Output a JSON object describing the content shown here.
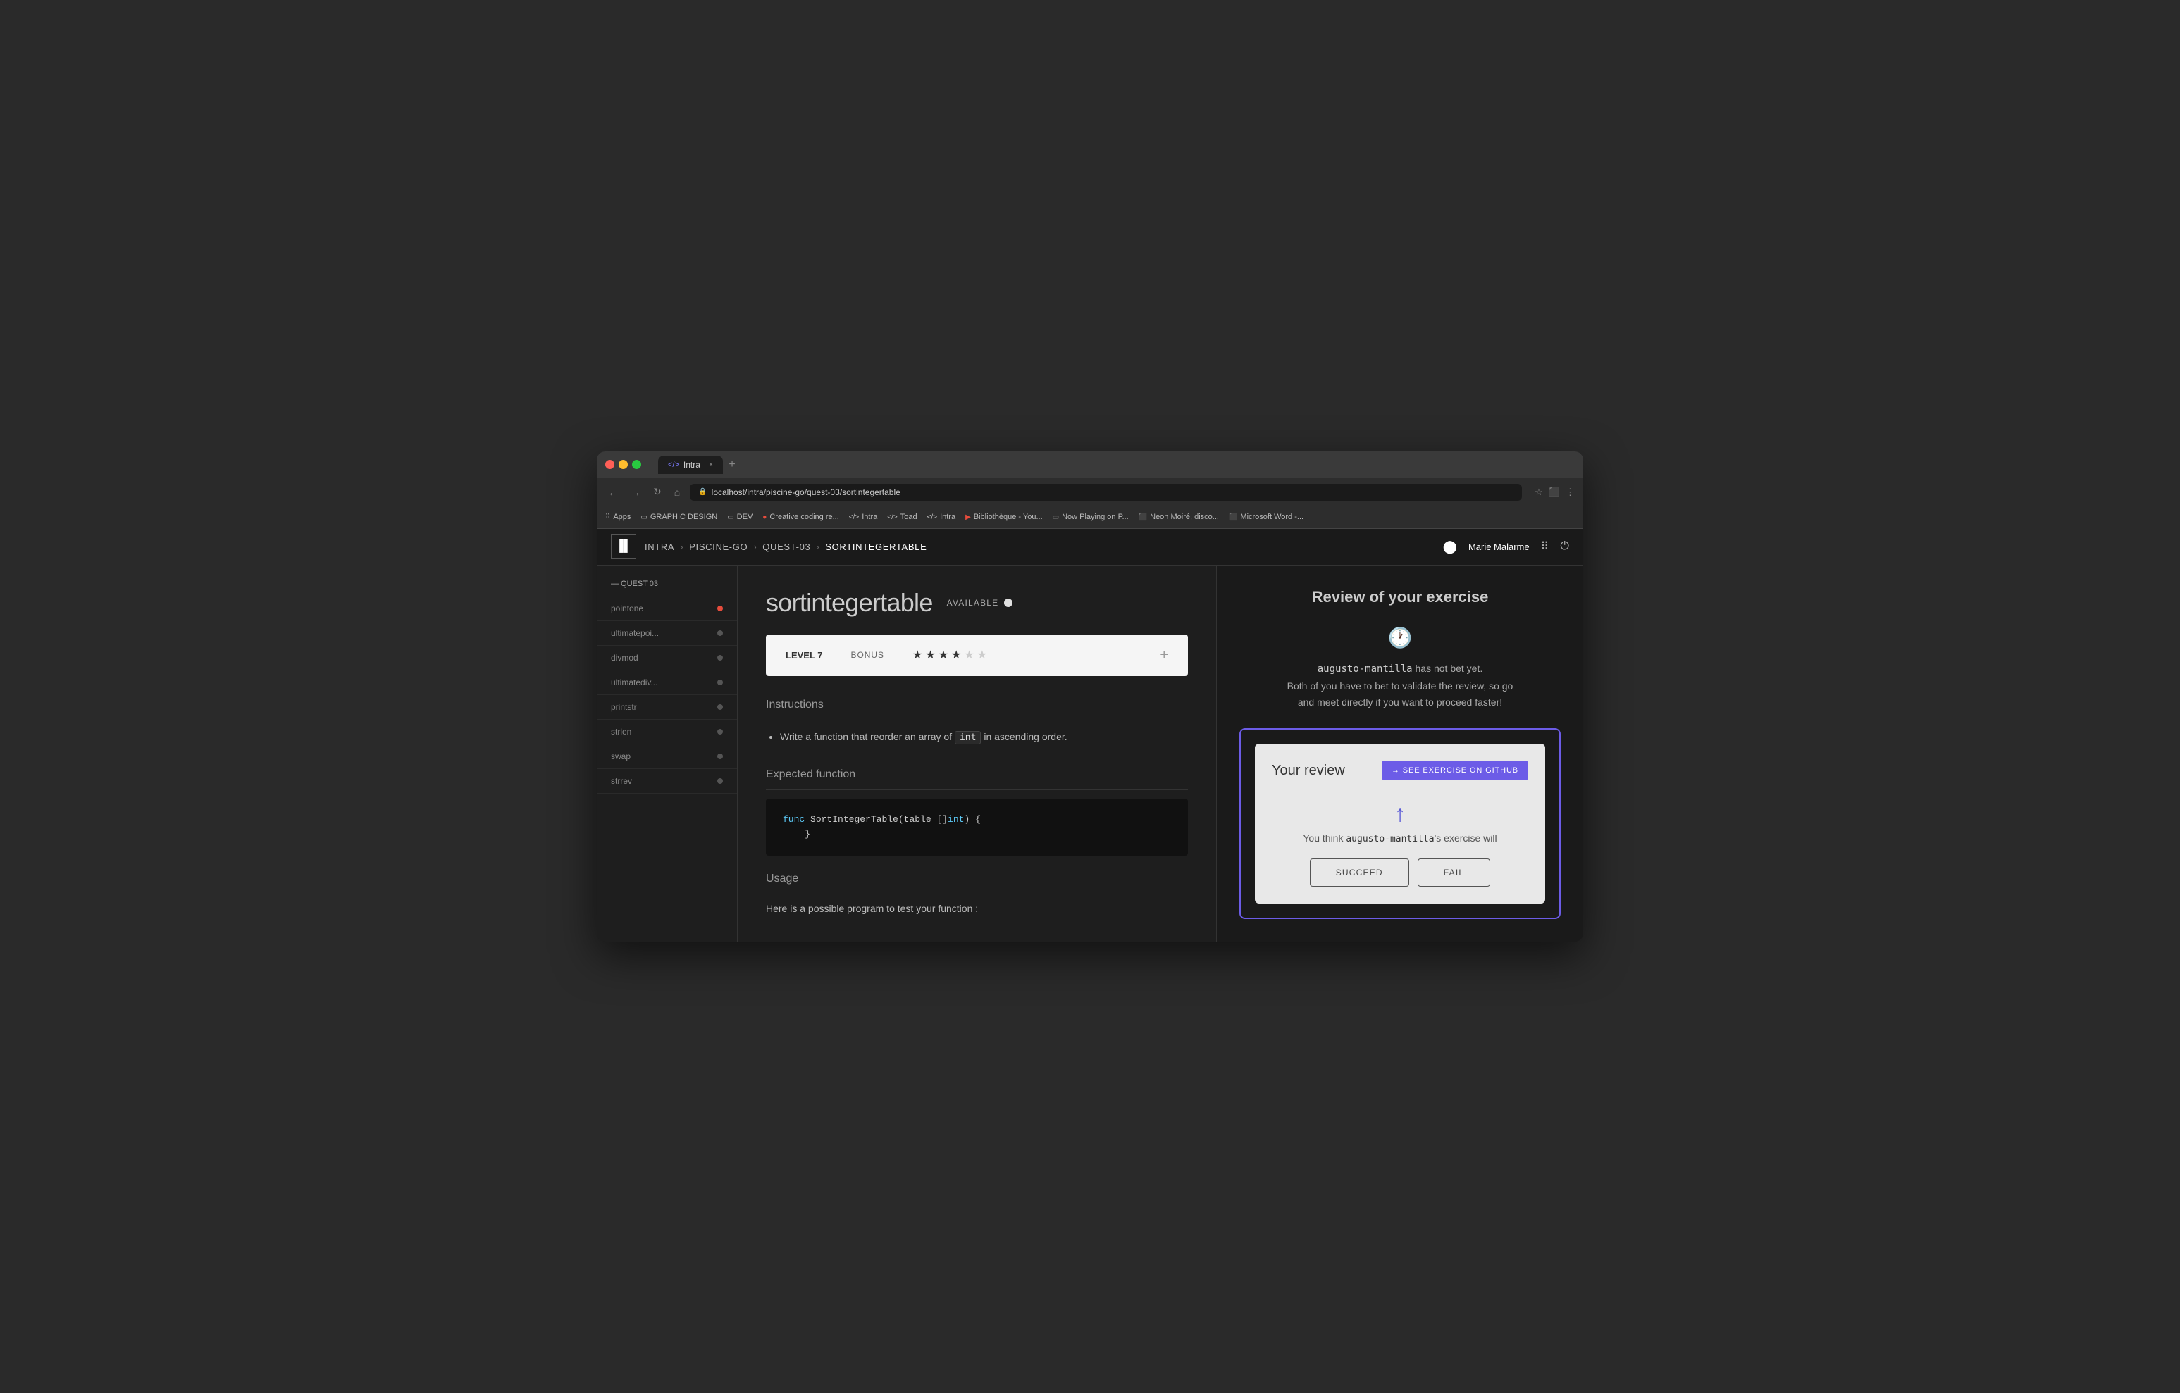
{
  "browser": {
    "tab_icon": "</>",
    "tab_title": "Intra",
    "tab_close": "×",
    "new_tab": "+",
    "url": "localhost/intra/piscine-go/quest-03/sortintegertable",
    "bookmarks": [
      {
        "icon": "⠿",
        "label": "Apps"
      },
      {
        "icon": "▭",
        "label": "GRAPHIC DESIGN"
      },
      {
        "icon": "▭",
        "label": "DEV"
      },
      {
        "icon": "🔴",
        "label": "Creative coding re..."
      },
      {
        "icon": "</>",
        "label": "Intra"
      },
      {
        "icon": "</>",
        "label": "Toad"
      },
      {
        "icon": "</>",
        "label": "Intra"
      },
      {
        "icon": "▶",
        "label": "Bibliothèque - You..."
      },
      {
        "icon": "▭",
        "label": "Now Playing on P..."
      },
      {
        "icon": "⬛",
        "label": "Neon Moiré, disco..."
      },
      {
        "icon": "⬛",
        "label": "Microsoft Word -..."
      }
    ]
  },
  "nav": {
    "logo": "▐▌",
    "breadcrumbs": [
      "INTRA",
      "PISCINE-GO",
      "QUEST-03",
      "SORTINTEGERTABLE"
    ],
    "user": "Marie Malarme"
  },
  "sidebar": {
    "section_title": "— QUEST 03",
    "items": [
      {
        "label": "pointone",
        "dot": "red"
      },
      {
        "label": "ultimatepoi...",
        "dot": "gray"
      },
      {
        "label": "divmod",
        "dot": "gray"
      },
      {
        "label": "ultimatediv...",
        "dot": "gray"
      },
      {
        "label": "printstr",
        "dot": "gray"
      },
      {
        "label": "strlen",
        "dot": "gray"
      },
      {
        "label": "swap",
        "dot": "gray"
      },
      {
        "label": "strrev",
        "dot": "gray"
      }
    ]
  },
  "exercise": {
    "name": "sortintegertable",
    "status": "AVAILABLE",
    "level": "LEVEL 7",
    "bonus": "BONUS",
    "stars_filled": 4,
    "stars_empty": 2,
    "sections": {
      "instructions": {
        "title": "Instructions",
        "items": [
          "Write a function that reorder an array of",
          "int",
          "in ascending order."
        ]
      },
      "expected_function": {
        "title": "Expected function",
        "code_line1": "func SortIntegerTable(table []int) {",
        "code_line2": "}"
      },
      "usage": {
        "title": "Usage",
        "text": "Here is a possible program to test your function :"
      }
    }
  },
  "review": {
    "title": "Review of your exercise",
    "clock_symbol": "🕐",
    "reviewer": "augusto-mantilla",
    "message_part1": "has not bet yet.",
    "message_part2": "Both of you have to bet to validate the review, so go",
    "message_part3": "and meet directly if you want to proceed faster!",
    "card": {
      "title": "Your review",
      "github_btn": "→ SEE EXERCISE ON GITHUB",
      "think_text": "You think",
      "reviewee": "augusto-mantilla",
      "think_text2": "'s exercise will",
      "succeed_btn": "SUCCEED",
      "fail_btn": "FAIL"
    }
  }
}
